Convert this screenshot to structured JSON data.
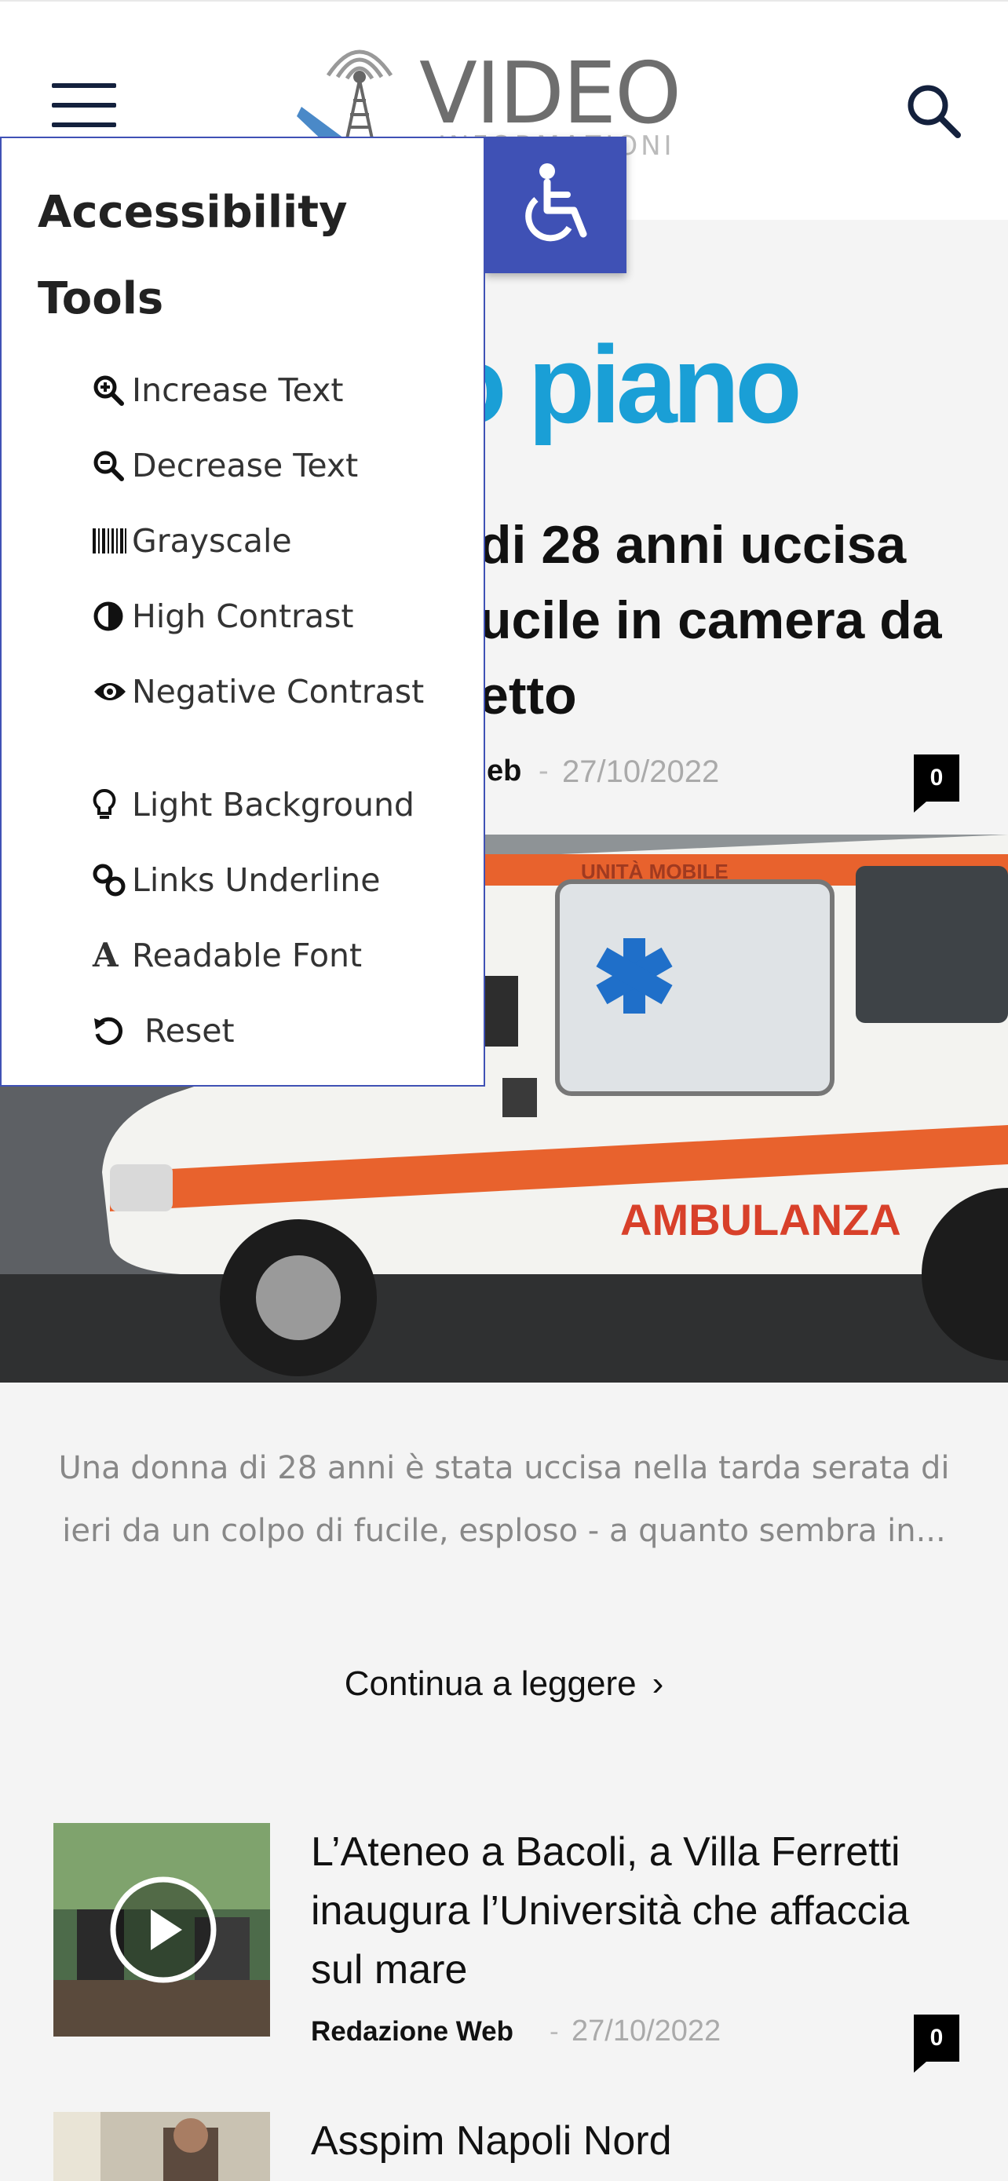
{
  "header": {
    "logo_text": "VIDEO",
    "logo_subtext": "INFORMAZIONI",
    "menu_icon": "hamburger-icon",
    "search_icon": "search-icon"
  },
  "accessibility": {
    "toggle_icon": "wheelchair-icon",
    "title": "Accessibility Tools",
    "tools": [
      {
        "label": "Increase Text",
        "icon": "zoom-in-icon"
      },
      {
        "label": "Decrease Text",
        "icon": "zoom-out-icon"
      },
      {
        "label": "Grayscale",
        "icon": "barcode-icon"
      },
      {
        "label": "High Contrast",
        "icon": "contrast-icon"
      },
      {
        "label": "Negative Contrast",
        "icon": "eye-icon"
      },
      {
        "label": "Light Background",
        "icon": "lightbulb-icon"
      },
      {
        "label": "Links Underline",
        "icon": "link-icon"
      },
      {
        "label": "Readable Font",
        "icon": "font-icon"
      },
      {
        "label": "Reset",
        "icon": "reset-icon"
      }
    ]
  },
  "featured": {
    "section_title": "o piano",
    "headline": "di 28 anni uccisa ucile in camera da etto",
    "author": "eb",
    "separator": "-",
    "date": "27/10/2022",
    "comments": "0",
    "hero_text": "AMBULANZA",
    "hero_top_text": "UNITÀ MOBILE",
    "excerpt": "Una donna di 28 anni è stata uccisa nella tarda serata di ieri da un colpo di fucile, esploso - a quanto sembra in...",
    "continue_label": "Continua a leggere",
    "continue_icon": "chevron-right-icon"
  },
  "articles": [
    {
      "title": "L’Ateneo a Bacoli, a Villa Ferretti inaugura l’Università che affaccia sul mare",
      "author": "Redazione Web",
      "separator": "-",
      "date": "27/10/2022",
      "comments": "0",
      "thumb_icon": "play-icon"
    },
    {
      "title": "Asspim Napoli Nord"
    }
  ],
  "colors": {
    "accent_blue": "#3f51b5",
    "title_blue": "#1a9fd6",
    "navy": "#14213d"
  }
}
